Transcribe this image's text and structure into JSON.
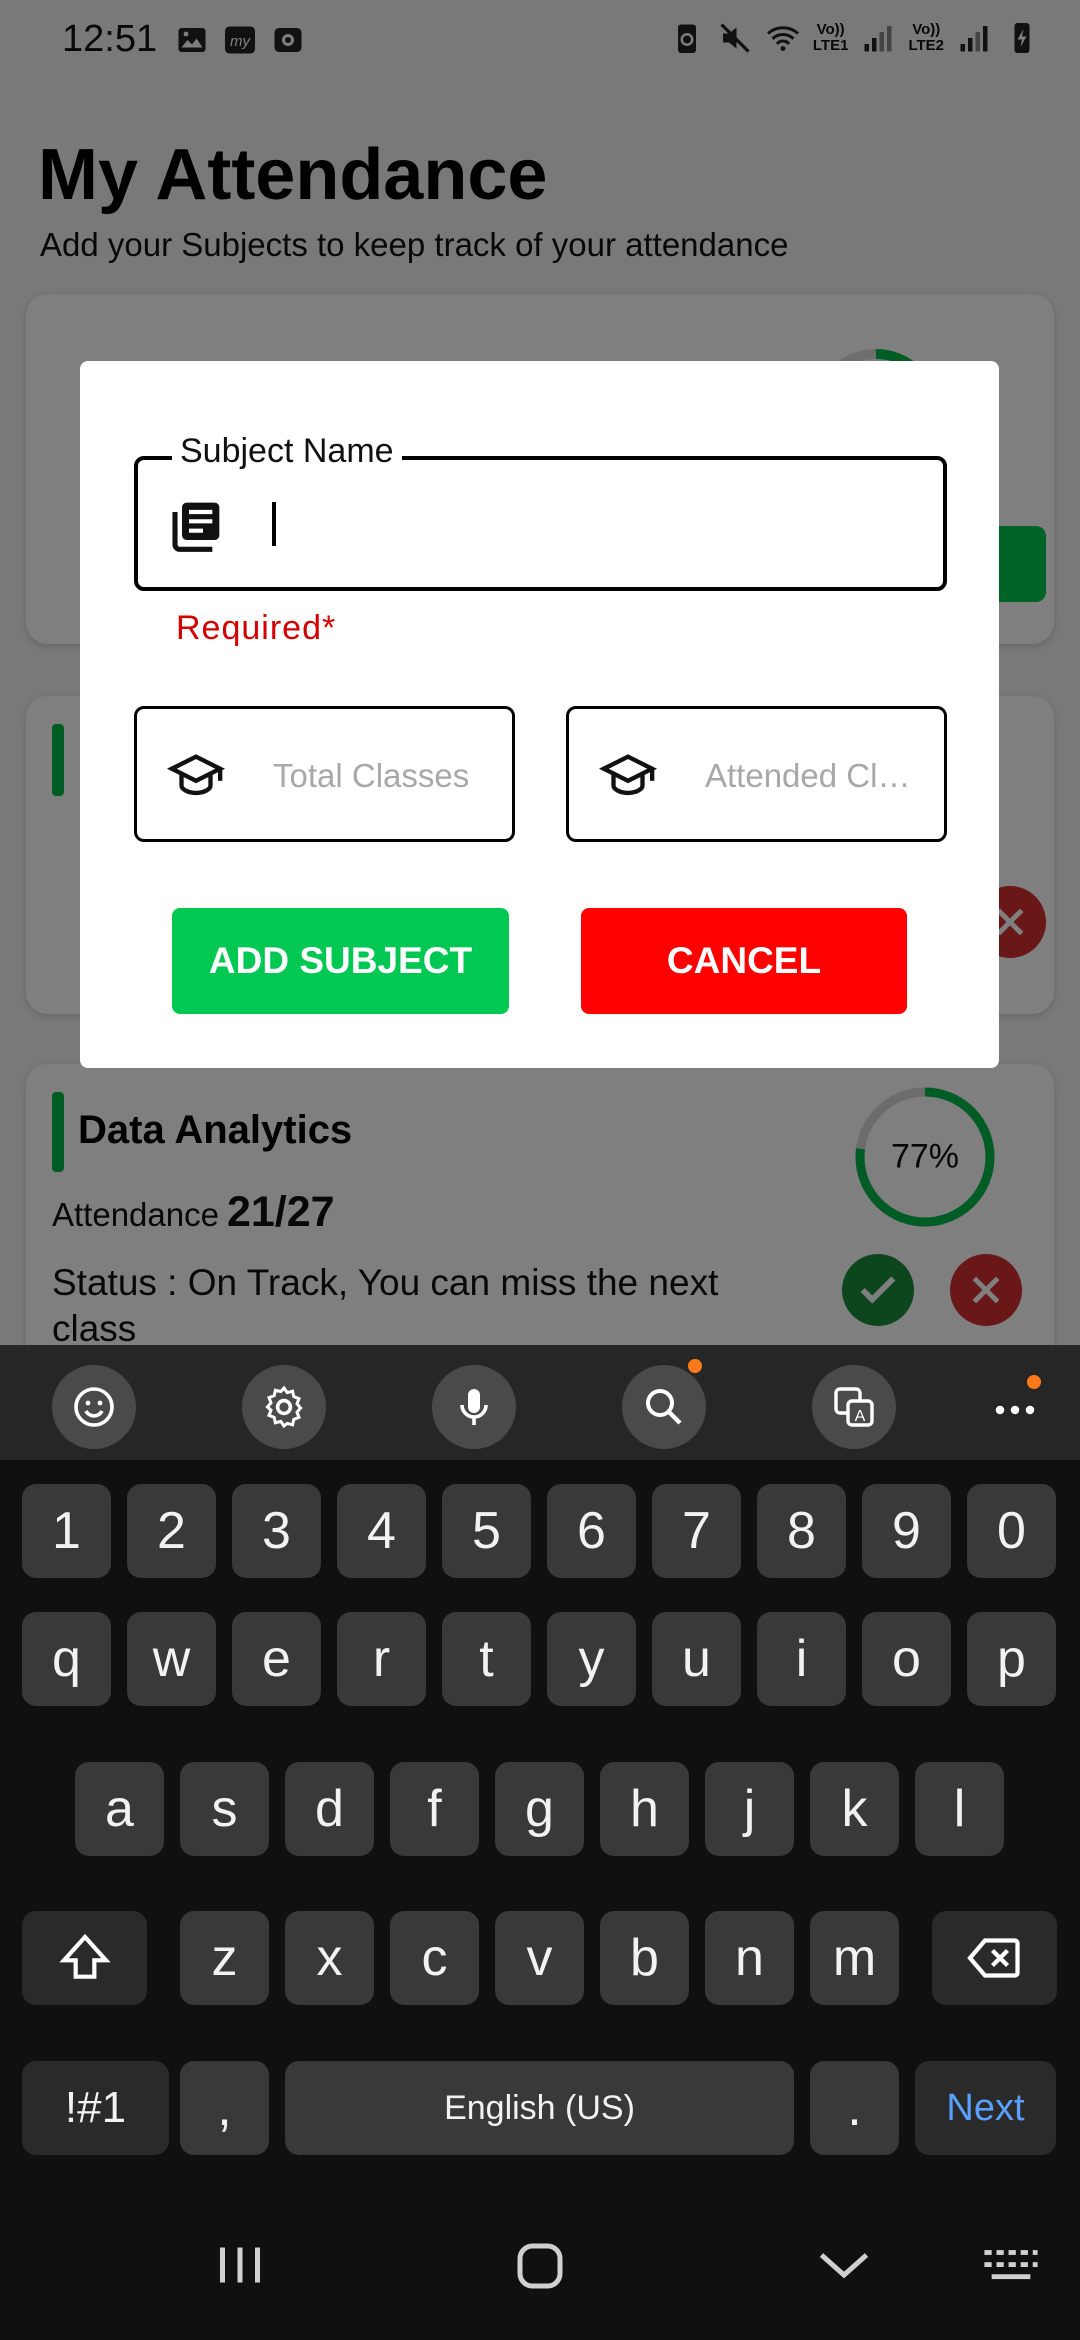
{
  "status_bar": {
    "time": "12:51",
    "left_icons": [
      "gallery-icon",
      "myjio-icon",
      "camera-icon"
    ],
    "right_icons": [
      "battery-saver-icon",
      "mute-icon",
      "wifi-icon",
      "signal-sim1-icon",
      "signal-sim2-icon",
      "battery-icon"
    ],
    "net1_label_top": "Vo))",
    "net1_label_bottom": "LTE1",
    "net2_label_top": "Vo))",
    "net2_label_bottom": "LTE2"
  },
  "page": {
    "title": "My Attendance",
    "subtitle": "Add your Subjects to keep track of your attendance"
  },
  "cards": [
    {
      "title": "Data Analytics",
      "attendance_label": "Attendance",
      "attendance_value": "21/27",
      "status": "Status : On Track, You can miss the next class",
      "percent_label": "77%",
      "percent": 77
    }
  ],
  "dialog": {
    "subject_field_label": "Subject Name",
    "subject_field_value": "",
    "error": "Required*",
    "total_classes_placeholder": "Total Classes",
    "attended_classes_placeholder": "Attended Classes",
    "add_button": "ADD SUBJECT",
    "cancel_button": "CANCEL"
  },
  "colors": {
    "accent_green": "#00c853",
    "cancel_red": "#ff0000",
    "error_red": "#d40000",
    "keyboard_bg": "#101010",
    "key_bg": "#393939",
    "next_blue": "#5aa0ff"
  },
  "keyboard": {
    "toolbar_icons": [
      "emoji-icon",
      "settings-icon",
      "microphone-icon",
      "search-icon",
      "translate-icon",
      "more-icon"
    ],
    "row_numbers": [
      "1",
      "2",
      "3",
      "4",
      "5",
      "6",
      "7",
      "8",
      "9",
      "0"
    ],
    "row_top": [
      "q",
      "w",
      "e",
      "r",
      "t",
      "y",
      "u",
      "i",
      "o",
      "p"
    ],
    "row_middle": [
      "a",
      "s",
      "d",
      "f",
      "g",
      "h",
      "j",
      "k",
      "l"
    ],
    "row_bottom": [
      "z",
      "x",
      "c",
      "v",
      "b",
      "n",
      "m"
    ],
    "symbols_key": "!#1",
    "comma_key": ",",
    "space_key": "English (US)",
    "period_key": ".",
    "next_key": "Next"
  },
  "nav_bar": {
    "icons": [
      "recents-icon",
      "home-icon",
      "back-icon",
      "keyboard-switch-icon"
    ]
  }
}
